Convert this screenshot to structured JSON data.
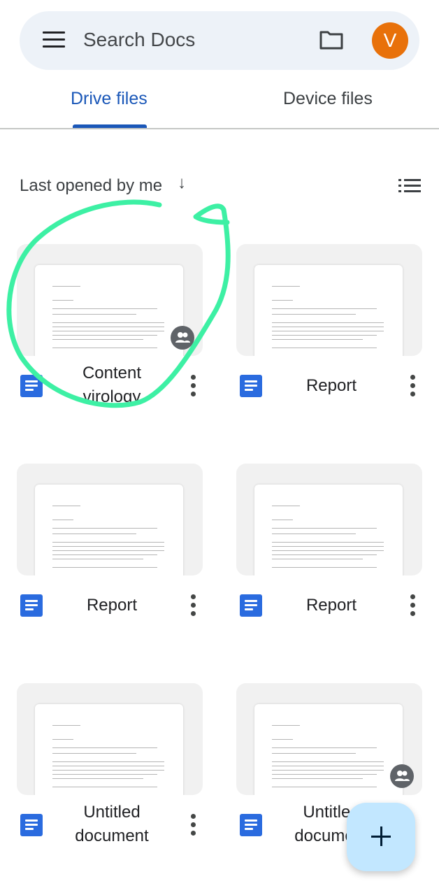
{
  "search": {
    "placeholder": "Search Docs",
    "avatar_letter": "V"
  },
  "colors": {
    "accent": "#1a57b8",
    "avatar": "#e8710a",
    "fab": "#c2e7ff",
    "doc_icon": "#2a6bdf",
    "annotation": "#3df0a4"
  },
  "tabs": [
    {
      "label": "Drive files",
      "active": true
    },
    {
      "label": "Device files",
      "active": false
    }
  ],
  "sort": {
    "label": "Last opened by me",
    "arrow": "↓"
  },
  "files": [
    {
      "title_lines": [
        "Content",
        "virology"
      ],
      "shared": true
    },
    {
      "title_lines": [
        "Report"
      ],
      "shared": false
    },
    {
      "title_lines": [
        "Report"
      ],
      "shared": false
    },
    {
      "title_lines": [
        "Report"
      ],
      "shared": false
    },
    {
      "title_lines": [
        "Untitled",
        "document"
      ],
      "shared": false
    },
    {
      "title_lines": [
        "Untitled",
        "document"
      ],
      "shared": true
    }
  ],
  "fab": {
    "label": "+"
  }
}
